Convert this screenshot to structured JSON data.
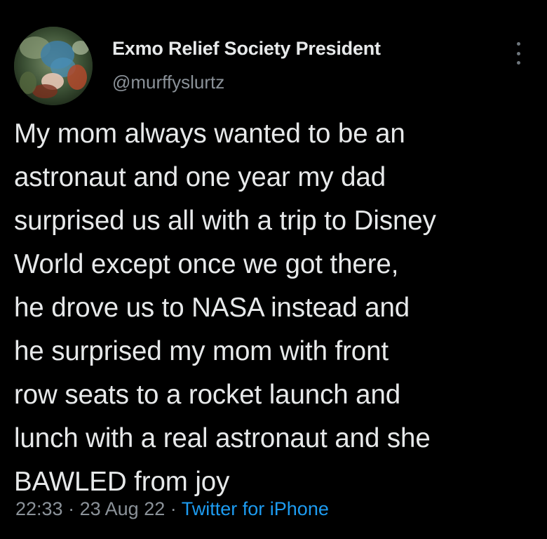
{
  "tweet": {
    "display_name": "Exmo Relief Society President",
    "handle": "@murffyslurtz",
    "text": "My mom always wanted to be an\nastronaut and one year my dad\nsurprised us all with a trip to Disney\nWorld except once we got there,\nhe drove us to NASA instead and\nhe surprised my mom with front\nrow seats to a rocket launch and\nlunch with a real astronaut and she\nBAWLED from joy",
    "time": "22:33",
    "separator": "·",
    "date": "23 Aug 22",
    "source": "Twitter for iPhone"
  },
  "icons": {
    "avatar": "profile-photo",
    "more": "more-vertical-icon"
  },
  "colors": {
    "background": "#000000",
    "text": "#e7e9ea",
    "secondary": "#8b9299",
    "link": "#1d9bf0"
  }
}
